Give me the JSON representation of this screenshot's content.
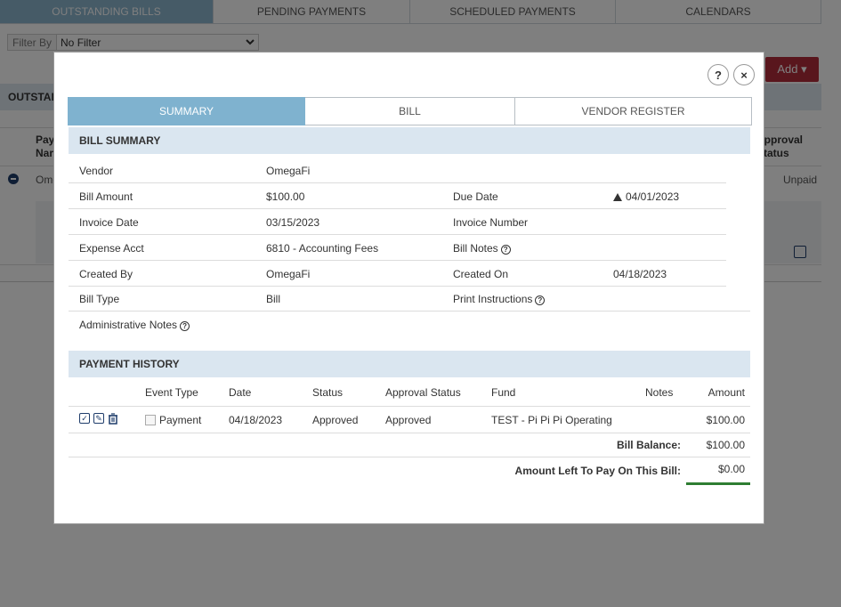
{
  "background": {
    "tabs": [
      "OUTSTANDING BILLS",
      "PENDING PAYMENTS",
      "SCHEDULED PAYMENTS",
      "CALENDARS"
    ],
    "filter_label": "Filter By",
    "filter_value": "No Filter",
    "add_button": "Add ▾",
    "section_title": "OUTSTAI",
    "col_pay": "Pay\nNar",
    "col_approval": "Approval\nStatus",
    "row_name": "Ome",
    "row_status": "Unpaid"
  },
  "modal": {
    "help": "?",
    "close": "×",
    "tabs": [
      "SUMMARY",
      "BILL",
      "VENDOR REGISTER"
    ],
    "bill_summary_title": "BILL SUMMARY",
    "summary": {
      "vendor_label": "Vendor",
      "vendor": "OmegaFi",
      "bill_amount_label": "Bill Amount",
      "bill_amount": "$100.00",
      "due_date_label": "Due Date",
      "due_date": "04/01/2023",
      "invoice_date_label": "Invoice Date",
      "invoice_date": "03/15/2023",
      "invoice_number_label": "Invoice Number",
      "expense_acct_label": "Expense Acct",
      "expense_acct": "6810 - Accounting Fees",
      "bill_notes_label": "Bill Notes",
      "created_by_label": "Created By",
      "created_by": "OmegaFi",
      "created_on_label": "Created On",
      "created_on": "04/18/2023",
      "bill_type_label": "Bill Type",
      "bill_type": "Bill",
      "print_instructions_label": "Print Instructions",
      "admin_notes_label": "Administrative Notes"
    },
    "payment_history_title": "PAYMENT HISTORY",
    "payment_history": {
      "columns": [
        "Event Type",
        "Date",
        "Status",
        "Approval Status",
        "Fund",
        "Notes",
        "Amount"
      ],
      "rows": [
        {
          "event_type": "Payment",
          "date": "04/18/2023",
          "status": "Approved",
          "approval_status": "Approved",
          "fund": "TEST - Pi Pi Pi Operating",
          "notes": "",
          "amount": "$100.00"
        }
      ],
      "bill_balance_label": "Bill Balance:",
      "bill_balance": "$100.00",
      "left_to_pay_label": "Amount Left To Pay On This Bill:",
      "left_to_pay": "$0.00"
    }
  }
}
